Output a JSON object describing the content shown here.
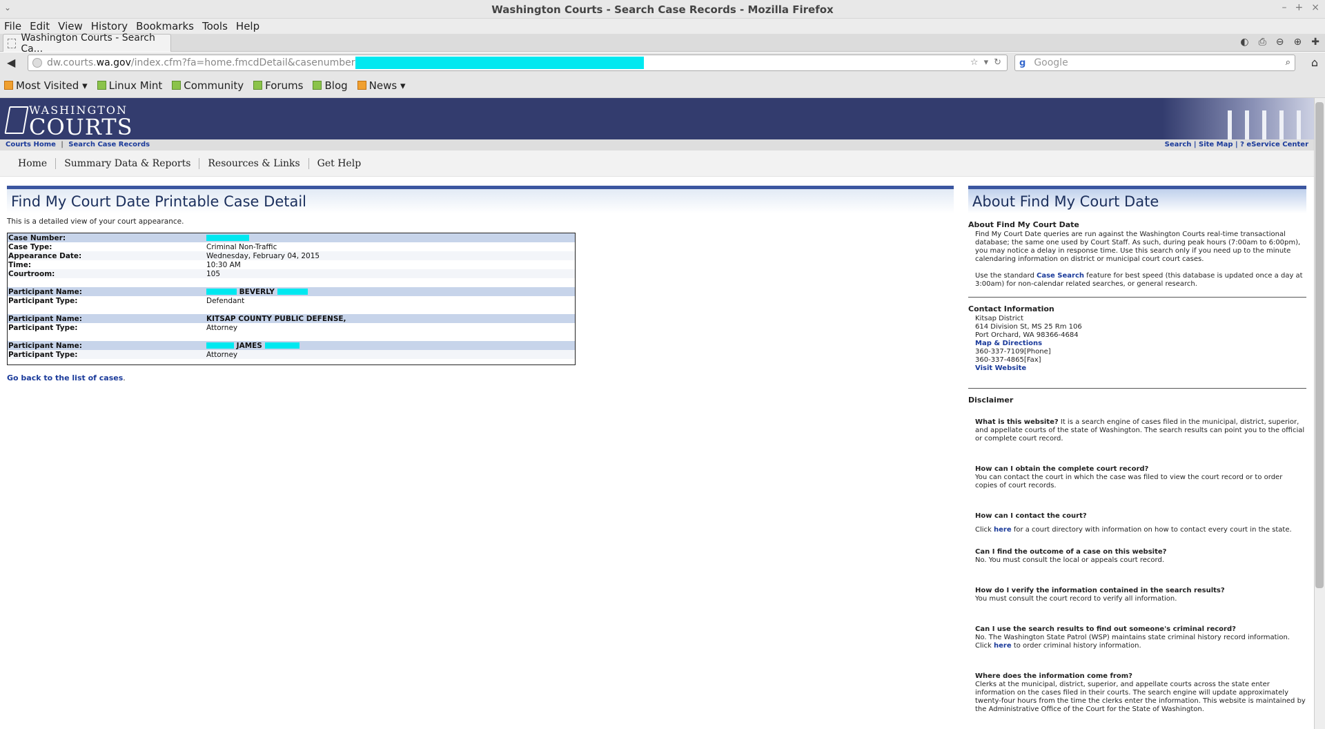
{
  "window": {
    "title": "Washington Courts - Search Case Records - Mozilla Firefox",
    "window_menu": "⌄",
    "minimize": "–",
    "maximize": "+",
    "close": "×"
  },
  "menubar": [
    "File",
    "Edit",
    "View",
    "History",
    "Bookmarks",
    "Tools",
    "Help"
  ],
  "tab": {
    "label": "Washington Courts - Search Ca..."
  },
  "url": {
    "prefix": "dw.courts.",
    "domain": "wa.gov",
    "path": "/index.cfm?fa=home.fmcdDetail&casenumber"
  },
  "search": {
    "engine": "g",
    "placeholder": "Google"
  },
  "bookmarks": [
    {
      "label": "Most Visited ▾",
      "icon": "most-visited-icon"
    },
    {
      "label": "Linux Mint",
      "icon": "bookmark-icon"
    },
    {
      "label": "Community",
      "icon": "bookmark-icon"
    },
    {
      "label": "Forums",
      "icon": "bookmark-icon"
    },
    {
      "label": "Blog",
      "icon": "bookmark-icon"
    },
    {
      "label": "News ▾",
      "icon": "rss-icon"
    }
  ],
  "site": {
    "logo_line1": "WASHINGTON",
    "logo_line2": "COURTS",
    "crumb_home": "Courts Home",
    "crumb_sep": "|",
    "crumb_search": "Search Case Records",
    "util_links": "Search | Site Map |  ?  eService Center",
    "nav": [
      "Home",
      "Summary Data & Reports",
      "Resources & Links",
      "Get Help"
    ]
  },
  "main": {
    "heading": "Find My Court Date Printable Case Detail",
    "intro": "This is a detailed view of your court appearance.",
    "case": {
      "case_number_label": "Case Number:",
      "case_type_label": "Case Type:",
      "case_type": "Criminal Non-Traffic",
      "appearance_label": "Appearance Date:",
      "appearance_date": "Wednesday, February 04, 2015",
      "time_label": "Time:",
      "time": "10:30 AM",
      "courtroom_label": "Courtroom:",
      "courtroom": "105"
    },
    "participants": [
      {
        "name_label": "Participant Name:",
        "name_visible": "BEVERLY",
        "type_label": "Participant Type:",
        "type": "Defendant"
      },
      {
        "name_label": "Participant Name:",
        "name_visible": "KITSAP COUNTY PUBLIC DEFENSE,",
        "type_label": "Participant Type:",
        "type": "Attorney"
      },
      {
        "name_label": "Participant Name:",
        "name_visible": "JAMES",
        "type_label": "Participant Type:",
        "type": "Attorney"
      }
    ],
    "goback_link": "Go back to the list of cases",
    "goback_dot": "."
  },
  "sidebar": {
    "heading": "About Find My Court Date",
    "about_title": "About Find My Court Date",
    "about_text": "Find My Court Date queries are run against the Washington Courts real-time transactional database; the same one used by Court Staff. As such, during peak hours (7:00am to 6:00pm), you may notice a delay in response time. Use this search only if you need up to the minute calendaring information on district or municipal court court cases.",
    "use_prefix": "Use the standard ",
    "use_link": "Case Search",
    "use_suffix": " feature for best speed (this database is updated once a day at 3:00am) for non-calendar related searches, or general research.",
    "contact_title": "Contact Information",
    "contact_name": "Kitsap District",
    "contact_addr1": "614 Division St, MS 25 Rm 106",
    "contact_addr2": "Port Orchard, WA 98366-4684",
    "contact_map": "Map & Directions",
    "contact_phone": "360-337-7109[Phone]",
    "contact_fax": "360-337-4865[Fax]",
    "contact_web": "Visit Website",
    "disclaimer_title": "Disclaimer",
    "faq1_q": "What is this website?",
    "faq1_a": " It is a search engine of cases filed in the municipal, district, superior, and appellate courts of the state of Washington. The search results can point you to the official or complete court record.",
    "faq2_q": "How can I obtain the complete court record?",
    "faq2_a": "You can contact the court in which the case was filed to view the court record or to order copies of court records.",
    "faq3_q": "How can I contact the court?",
    "faq3_pre": "Click ",
    "faq3_link": "here",
    "faq3_post": " for a court directory with information on how to contact every court in the state.",
    "faq4_q": "Can I find the outcome of a case on this website?",
    "faq4_a": "No. You must consult the local or appeals court record.",
    "faq5_q": "How do I verify the information contained in the search results?",
    "faq5_a": "You must consult the court record to verify all information.",
    "faq6_q": "Can I use the search results to find out someone's criminal record?",
    "faq6_pre": "No. The Washington State Patrol (WSP) maintains state criminal history record information. Click ",
    "faq6_link": "here",
    "faq6_post": " to order criminal history information.",
    "faq7_q": "Where does the information come from?",
    "faq7_a": "Clerks at the municipal, district, superior, and appellate courts across the state enter information on the cases filed in their courts. The search engine will update approximately twenty-four hours from the time the clerks enter the information. This website is maintained by the Administrative Office of the Court for the State of Washington."
  },
  "colors": {
    "header": "#333c6e",
    "link": "#1a3a9a",
    "redaction": "#00e8f0"
  }
}
